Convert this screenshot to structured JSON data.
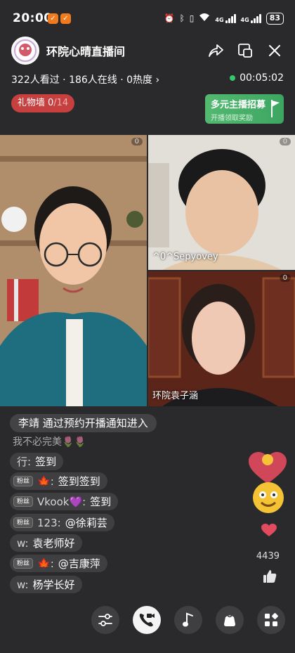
{
  "status_bar": {
    "time": "20:00",
    "network_label_1": "4G",
    "network_label_2": "4G",
    "battery": "83"
  },
  "header": {
    "room_title": "环院心晴直播间",
    "viewers": "322人看过 · 186人在线 · 0热度",
    "viewers_chevron": "›",
    "live_timer": "00:05:02",
    "gift_wall_label": "礼物墙",
    "gift_wall_count": "0",
    "gift_wall_total": "/14",
    "recruit_title": "多元主播招募",
    "recruit_subtitle": "开播领取奖励"
  },
  "videos": {
    "main_count": "0",
    "top_count": "0",
    "top_name": "^0^Sepyovey",
    "bottom_count": "0",
    "bottom_name": "环院袁子涵"
  },
  "chat": {
    "entry_banner": "李靖 通过预约开播通知进入",
    "faded_message": "我不必完美🌷🌷",
    "messages": [
      {
        "badge": "",
        "user": "行:",
        "text": "签到"
      },
      {
        "badge": "粉丝",
        "user": "🍁:",
        "text": "签到签到"
      },
      {
        "badge": "粉丝",
        "user": "Vkook💜:",
        "text": "签到"
      },
      {
        "badge": "粉丝",
        "user": "123:",
        "text": "@徐莉芸"
      },
      {
        "badge": "",
        "user": "w:",
        "text": "袁老师好"
      },
      {
        "badge": "粉丝",
        "user": "🍁:",
        "text": "@吉康萍"
      },
      {
        "badge": "",
        "user": "w:",
        "text": "杨学长好"
      }
    ]
  },
  "side": {
    "like_count": "4439"
  },
  "icons": {
    "share": "share-icon",
    "pip": "picture-in-picture-icon",
    "close": "close-icon",
    "settings": "sliders-icon",
    "call": "video-call-icon",
    "music": "music-icon",
    "gift": "gift-bag-icon",
    "more": "apps-grid-icon",
    "like": "thumbs-up-icon"
  },
  "colors": {
    "accent_green": "#35c86a",
    "gift_wall_red": "#c64040",
    "recruit_green": "#4ab067"
  }
}
